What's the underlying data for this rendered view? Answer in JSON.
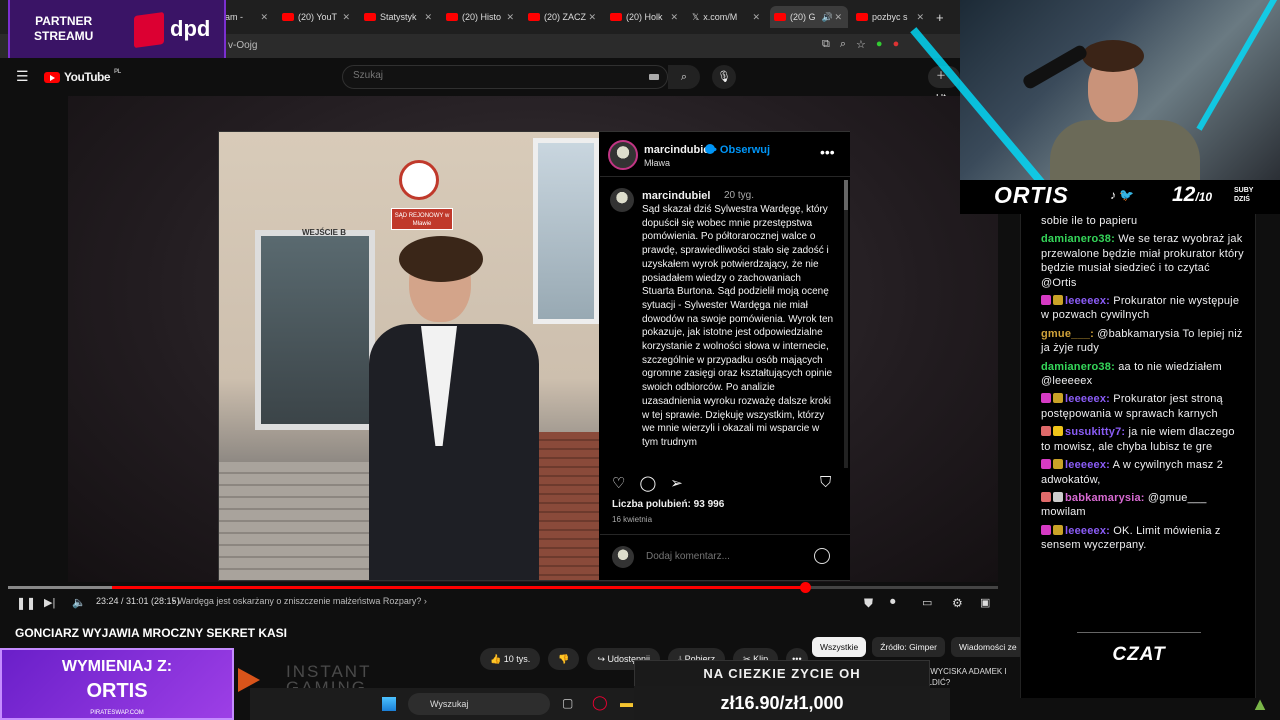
{
  "browser": {
    "tabs": [
      {
        "label": "eam - "
      },
      {
        "label": "(20) YouT"
      },
      {
        "label": "Statystyk"
      },
      {
        "label": "(20) Histo"
      },
      {
        "label": "(20) ZACZ"
      },
      {
        "label": "(20) Holk"
      },
      {
        "label": "x.com/M"
      },
      {
        "label": "(20) G"
      },
      {
        "label": "pozbyc s"
      }
    ],
    "new_tab": "+",
    "url_fragment": "v-Oojg"
  },
  "partner": {
    "line1": "PARTNER",
    "line2": "STREAMU",
    "brand": "dpd"
  },
  "youtube": {
    "logo": "YouTube",
    "region": "PL",
    "search_placeholder": "Szukaj",
    "create_label": "Ut"
  },
  "instagram": {
    "username": "marcindubiel",
    "follow": "Obserwuj",
    "location": "Mława",
    "more": "•••",
    "caption_user": "marcindubiel",
    "caption_time": "20 tyg.",
    "caption": "Sąd skazał dziś Sylwestra Wardęgę, który dopuścił się wobec mnie przestępstwa pomówienia. Po półtorarocznej walce o prawdę, sprawiedliwości stało się zadość i uzyskałem wyrok potwierdzający, że nie posiadałem wiedzy o zachowaniach Stuarta Burtona. Sąd podzielił moją ocenę sytuacji - Sylwester Wardęga nie miał dowodów na swoje pomówienia. Wyrok ten pokazuje, jak istotne jest odpowiedzialne korzystanie z wolności słowa w internecie, szczególnie w przypadku osób mających ogromne zasięgi oraz kształtujących opinie swoich odbiorców. Po analizie uzasadnienia wyroku rozważę dalsze kroki w tej sprawie. Dziękuję wszystkim, którzy we mnie wierzyli i okazali mi wsparcie w tym trudnym",
    "likes": "Liczba polubień: 93 996",
    "date": "16 kwietnia",
    "comment_placeholder": "Dodaj komentarz...",
    "photo_sign": "SĄD REJONOWY w Mławie",
    "photo_door": "WEJŚCIE B"
  },
  "player": {
    "progress_fraction": 0.805,
    "time": "23:24 / 31:01 (28:15)",
    "chapter": "• Wardęga jest oskarżany o zniszczenie małżeństwa Rozpary? ›"
  },
  "video": {
    "title": "GONCIARZ WYJAWIA MROCZNY SEKRET KASI",
    "likes": "10 tys.",
    "share": "Udostępnij",
    "download": "Pobierz",
    "clip": "Klip",
    "more": "•••"
  },
  "chips": [
    "Wszystkie",
    "Źródło: Gimper",
    "Wiadomości ze"
  ],
  "overlays": {
    "swap_line1": "WYMIENIAJ Z:",
    "swap_line2": "ORTIS",
    "swap_site": "PIRATESWAP.COM",
    "instant_gaming": "INSTANT GAMING",
    "ticker": "NA CIEZKIE ZYCIE OH",
    "price": "zł16.90/zł1,000",
    "news": "ILE WYCISKA ADAMEK I SOLDIĆ?",
    "taskbar_search": "Wyszukaj"
  },
  "stream": {
    "name": "ORTIS",
    "subs": "12",
    "subs_goal": "/10",
    "subs_label_1": "SUBY",
    "subs_label_2": "DZIŚ",
    "chat_label": "CZAT"
  },
  "chat": [
    {
      "user": "",
      "text": "sobie ile to papieru",
      "color": "#efeff1",
      "badges": []
    },
    {
      "user": "damianero38:",
      "text": " We se teraz wyobraż jak przewalone będzie miał prokurator który będzie musiał siedzieć i to czytać @Ortis",
      "color": "#35d65a",
      "badges": []
    },
    {
      "user": "leeeeex:",
      "text": " Prokurator nie występuje w pozwach cywilnych",
      "color": "#8a5cf6",
      "badges": [
        "#d63bc4",
        "#c9a227"
      ]
    },
    {
      "user": "gmue___:",
      "text": " @babkamarysia To lepiej niż ja żyje rudy",
      "color": "#d0a23a",
      "badges": []
    },
    {
      "user": "damianero38:",
      "text": " aa to nie wiedziałem @leeeeex",
      "color": "#35d65a",
      "badges": []
    },
    {
      "user": "leeeeex:",
      "text": " Prokurator jest stroną postępowania w sprawach karnych",
      "color": "#8a5cf6",
      "badges": [
        "#d63bc4",
        "#c9a227"
      ]
    },
    {
      "user": "susukitty7:",
      "text": " ja nie wiem dlaczego to mowisz, ale chyba lubisz te gre",
      "color": "#8a5cf6",
      "badges": [
        "#e06a6a",
        "#f0c419"
      ]
    },
    {
      "user": "leeeeex:",
      "text": " A w cywilnych masz 2 adwokatów,",
      "color": "#8a5cf6",
      "badges": [
        "#d63bc4",
        "#c9a227"
      ]
    },
    {
      "user": "babkamarysia:",
      "text": " @gmue___ mowilam",
      "color": "#d86ad2",
      "badges": [
        "#e06a6a",
        "#cccccc"
      ]
    },
    {
      "user": "leeeeex:",
      "text": " OK. Limit mówienia z sensem wyczerpany.",
      "color": "#8a5cf6",
      "badges": [
        "#d63bc4",
        "#c9a227"
      ]
    }
  ]
}
